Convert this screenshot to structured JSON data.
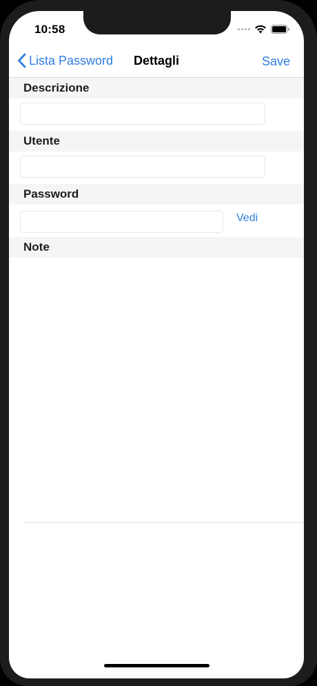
{
  "status_bar": {
    "time": "10:58",
    "icons": [
      "signal-dots-icon",
      "wifi-icon",
      "battery-icon"
    ]
  },
  "navbar": {
    "back_label": "Lista Password",
    "title": "Dettagli",
    "save_label": "Save"
  },
  "form": {
    "description": {
      "header": "Descrizione",
      "value": "",
      "placeholder": ""
    },
    "user": {
      "header": "Utente",
      "value": "",
      "placeholder": ""
    },
    "password": {
      "header": "Password",
      "value": "",
      "placeholder": "",
      "show_label": "Vedi"
    },
    "notes": {
      "header": "Note",
      "value": ""
    }
  },
  "colors": {
    "accent": "#2f7de1",
    "section_background": "#f5f5f7",
    "device_frame": "#1c1c1e"
  }
}
